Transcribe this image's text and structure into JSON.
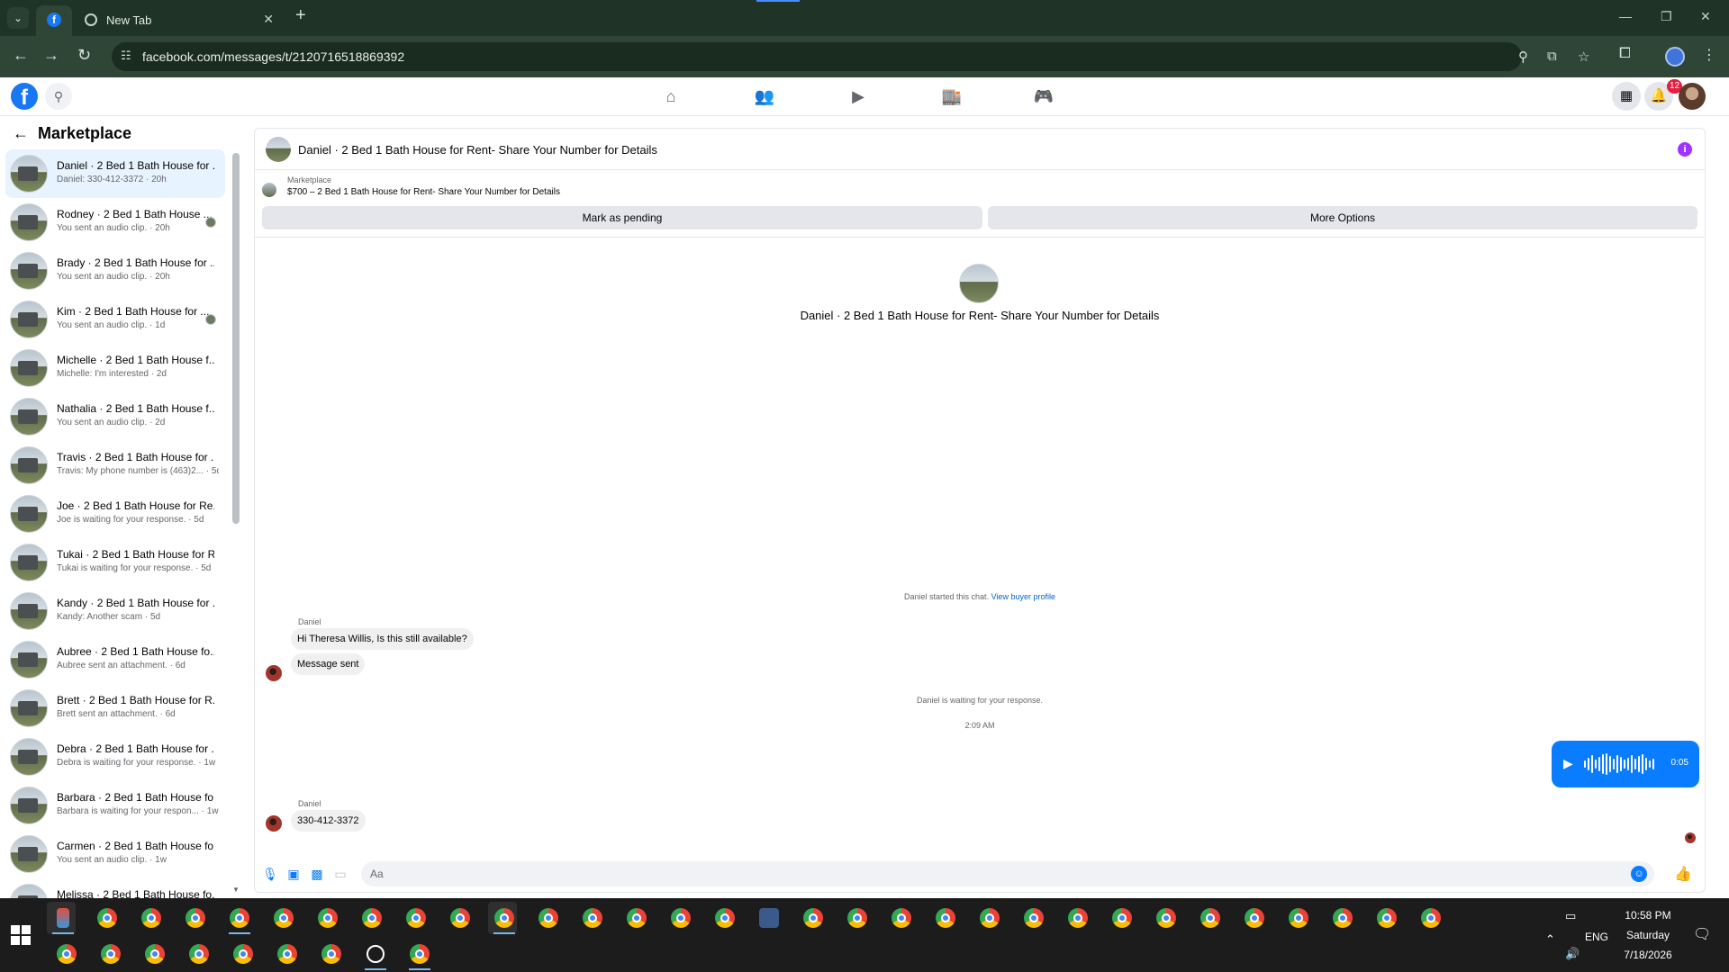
{
  "browser": {
    "tab_title": "New Tab",
    "url": "facebook.com/messages/t/2120716518869392"
  },
  "header": {
    "notification_count": "12"
  },
  "sidebar": {
    "title": "Marketplace",
    "conversations": [
      {
        "name": "Daniel · 2 Bed 1 Bath House for ...",
        "snippet": "Daniel: 330-412-3372 · 20h"
      },
      {
        "name": "Rodney · 2 Bed 1 Bath House ...",
        "snippet": "You sent an audio clip. · 20h"
      },
      {
        "name": "Brady · 2 Bed 1 Bath House for ...",
        "snippet": "You sent an audio clip. · 20h"
      },
      {
        "name": "Kim · 2 Bed 1 Bath House for ...",
        "snippet": "You sent an audio clip. · 1d"
      },
      {
        "name": "Michelle · 2 Bed 1 Bath House f...",
        "snippet": "Michelle: I'm interested · 2d"
      },
      {
        "name": "Nathalia · 2 Bed 1 Bath House f...",
        "snippet": "You sent an audio clip. · 2d"
      },
      {
        "name": "Travis · 2 Bed 1 Bath House for ...",
        "snippet": "Travis: My phone number is (463)2... · 5d"
      },
      {
        "name": "Joe · 2 Bed 1 Bath House for Re...",
        "snippet": "Joe is waiting for your response. · 5d"
      },
      {
        "name": "Tukai · 2 Bed 1 Bath House for R...",
        "snippet": "Tukai is waiting for your response. · 5d"
      },
      {
        "name": "Kandy · 2 Bed 1 Bath House for ...",
        "snippet": "Kandy: Another scam · 5d"
      },
      {
        "name": "Aubree · 2 Bed 1 Bath House fo...",
        "snippet": "Aubree sent an attachment. · 6d"
      },
      {
        "name": "Brett · 2 Bed 1 Bath House for R...",
        "snippet": "Brett sent an attachment. · 6d"
      },
      {
        "name": "Debra · 2 Bed 1 Bath House for ...",
        "snippet": "Debra is waiting for your response. · 1w"
      },
      {
        "name": "Barbara · 2 Bed 1 Bath House fo...",
        "snippet": "Barbara is waiting for your respon... · 1w"
      },
      {
        "name": "Carmen · 2 Bed 1 Bath House fo...",
        "snippet": "You sent an audio clip. · 1w"
      },
      {
        "name": "Melissa · 2 Bed 1 Bath House fo...",
        "snippet": ""
      }
    ]
  },
  "chat": {
    "title": "Daniel · 2 Bed 1 Bath House for Rent- Share Your Number for Details",
    "listing_category": "Marketplace",
    "listing_title": "$700 – 2 Bed 1 Bath House for Rent- Share Your Number for Details",
    "mark_pending_label": "Mark as pending",
    "more_options_label": "More Options",
    "started_text": "Daniel started this chat.",
    "view_profile_link": "View buyer profile",
    "sender_name": "Daniel",
    "message_1": "Hi Theresa Willis, Is this still available?",
    "message_2": "Message sent",
    "waiting_text": "Daniel is waiting for your response.",
    "timestamp": "2:09 AM",
    "audio_duration": "0:05",
    "message_3": "330-412-3372",
    "composer_placeholder": "Aa"
  },
  "taskbar": {
    "time": "10:58 PM",
    "day": "Saturday",
    "date": "7/18/2026",
    "language": "ENG"
  },
  "colors": {
    "fb_blue": "#1877f2",
    "messenger_blue": "#0a7cff",
    "browser_frame": "#1f3326",
    "active_conversation_bg": "#e7f3ff"
  }
}
